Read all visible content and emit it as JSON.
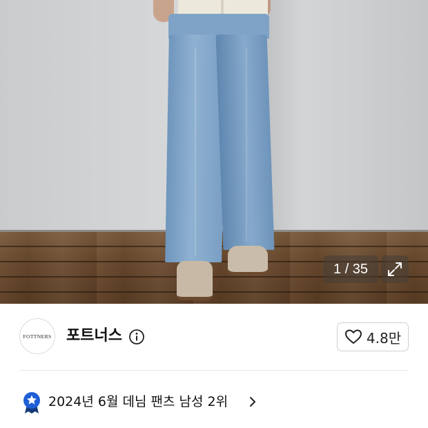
{
  "product_image": {
    "counter": "1 / 35",
    "expand_icon": "expand-arrows-icon"
  },
  "brand": {
    "logo_text": "FOTTNERS",
    "name": "포트너스",
    "info_icon": "info-circle-icon"
  },
  "like": {
    "icon": "heart-outline-icon",
    "count": "4.8만"
  },
  "ranking": {
    "badge_icon": "star-badge-icon",
    "text": "2024년 6월 데님 팬츠 남성 2위",
    "chevron_icon": "chevron-right-icon"
  },
  "colors": {
    "badge_blue": "#1f5fd6",
    "badge_ribbon": "#163a7a"
  }
}
